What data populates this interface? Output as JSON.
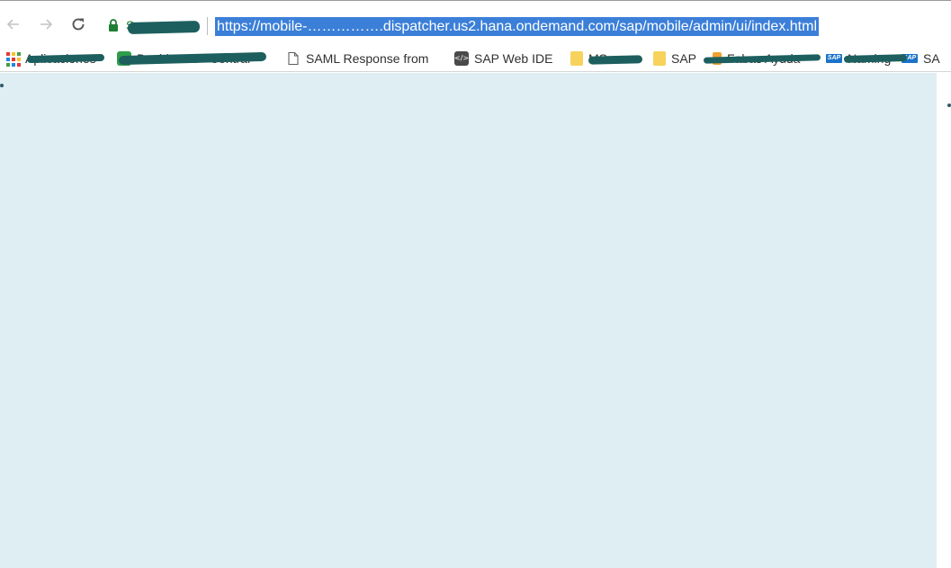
{
  "toolbar": {
    "address": {
      "secure_label": "Seguro",
      "url": "https://mobile-…………….dispatcher.us2.hana.ondemand.com/sap/mobile/admin/ui/index.html"
    }
  },
  "bookmarks": [
    {
      "label": "Aplicaciones",
      "icon": "apps-grid-icon"
    },
    {
      "label": "Dashboard - Central",
      "icon": "green-database-icon"
    },
    {
      "label": "SAML Response from",
      "icon": "page-icon"
    },
    {
      "label": "SAP Web IDE",
      "icon": "web-ide-icon"
    },
    {
      "label": "MSaas",
      "icon": "folder-icon"
    },
    {
      "label": "SAP",
      "icon": "folder-icon"
    },
    {
      "label": "Fabas Ayuda",
      "icon": "bookmark-icon"
    },
    {
      "label": "Naming",
      "icon": "sap-logo-icon"
    },
    {
      "label": "SA",
      "icon": "sap-logo-icon"
    }
  ],
  "colors": {
    "page_background": "#dfeef2",
    "url_highlight": "#3b7fd8",
    "secure_green": "#1e7e34",
    "redaction": "#1d5f5e"
  }
}
